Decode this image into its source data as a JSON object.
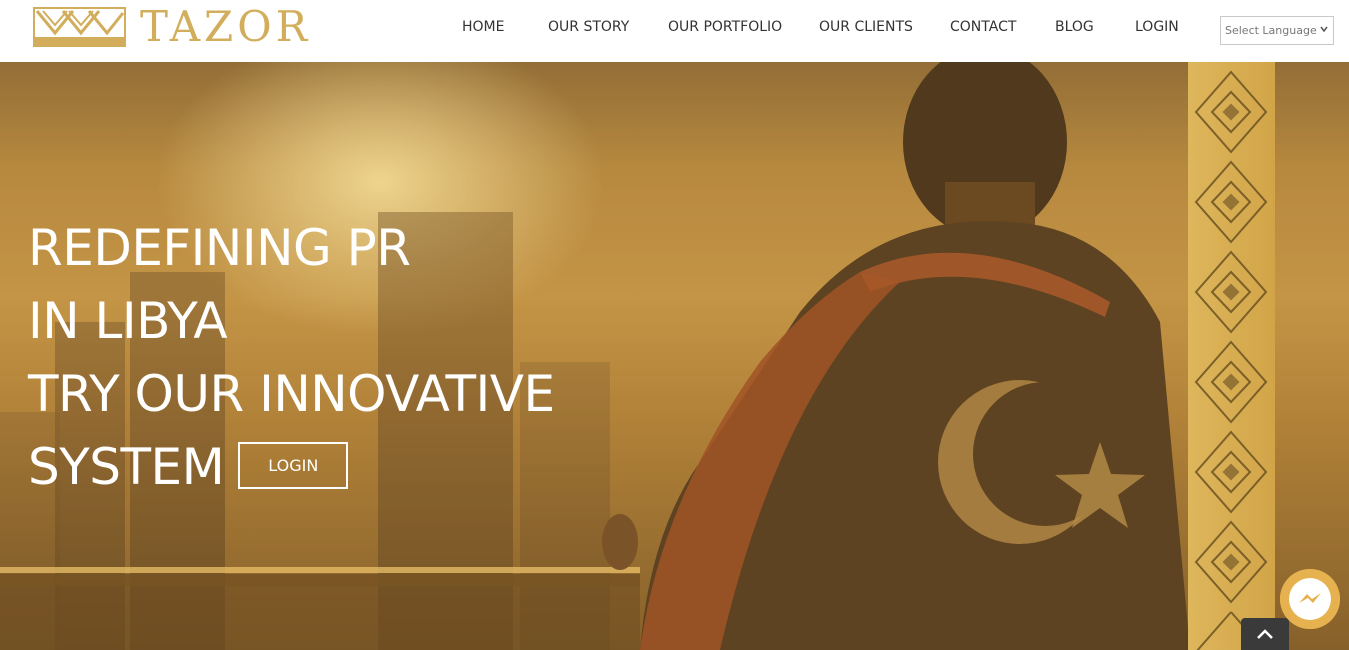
{
  "brand": {
    "name": "TAZOR",
    "color": "#d2ad5b"
  },
  "nav": {
    "items": [
      {
        "label": "HOME"
      },
      {
        "label": "OUR STORY"
      },
      {
        "label": "OUR PORTFOLIO"
      },
      {
        "label": "OUR CLIENTS"
      },
      {
        "label": "CONTACT"
      },
      {
        "label": "BLOG"
      },
      {
        "label": "LOGIN"
      }
    ]
  },
  "language": {
    "selected": "Select Language",
    "icon": "chevron-down-icon"
  },
  "hero": {
    "lines": [
      "REDEFINING PR",
      "IN LIBYA",
      "TRY OUR INNOVATIVE",
      "SYSTEM"
    ],
    "button_label": "LOGIN"
  },
  "floating": {
    "messenger_icon": "messenger-icon",
    "scroll_top_icon": "chevron-up-icon",
    "messenger_color": "#e6b24f"
  }
}
